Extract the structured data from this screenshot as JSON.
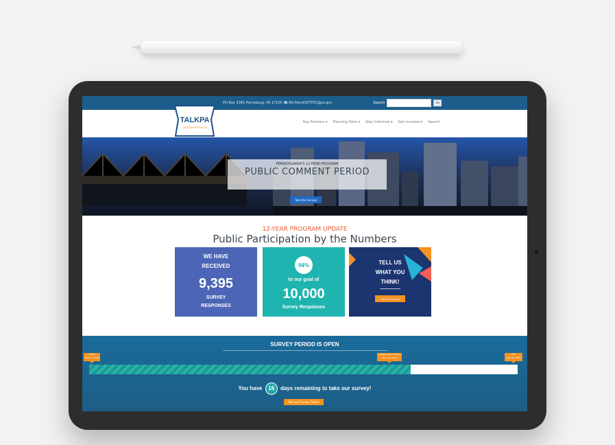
{
  "header": {
    "contact": "PO Box 3365 Harrisburg, PA 17105   ☎ RA-PennDOTSTC@pa.gov",
    "search_label": "Search",
    "search_value": "",
    "search_button": "Go"
  },
  "logo": {
    "name": "TALKPA",
    "sub": "TRANSPORTATION"
  },
  "nav": {
    "items": [
      "Key Partners ▾",
      "Planning Tools ▾",
      "Stay Informed ▾",
      "Get involved ▾",
      "Search"
    ]
  },
  "hero": {
    "kicker": "PENNSYLVANIA'S 12-YEAR PROGRAM",
    "title": "PUBLIC COMMENT PERIOD",
    "button": "Take the Survey"
  },
  "stats": {
    "kicker": "12-YEAR PROGRAM UPDATE",
    "title": "Public Participation by the Numbers",
    "card1": {
      "line1": "WE HAVE",
      "line2": "RECEIVED",
      "value": "9,395",
      "line3": "SURVEY",
      "line4": "RESPONSES"
    },
    "card2": {
      "percent": "94%",
      "line1": "to our goal of",
      "value": "10,000",
      "line2": "Survey Responses"
    },
    "card3": {
      "line1": "TELL US",
      "line2": "WHAT YOU",
      "line3": "THINK!",
      "button": "Take the Survey"
    }
  },
  "survey": {
    "title": "SURVEY PERIOD IS OPEN",
    "markers": [
      {
        "top": "START",
        "bottom": "March 1, 2022"
      },
      {
        "top": "Satellite Press Timing",
        "bottom": "April 12, 2022"
      },
      {
        "top": "END",
        "bottom": "April 30, 2022"
      }
    ],
    "progress": 0.75,
    "remaining_prefix": "You have",
    "remaining_days": "16",
    "remaining_suffix": "days remaining to take our survey!",
    "button": "Take our Survey Today!"
  },
  "colors": {
    "topbar": "#1c5e8b",
    "accent_orange": "#f39324",
    "accent_teal": "#1fb4b0",
    "card_blue": "#4c65b6",
    "card_navy": "#1c3470"
  }
}
